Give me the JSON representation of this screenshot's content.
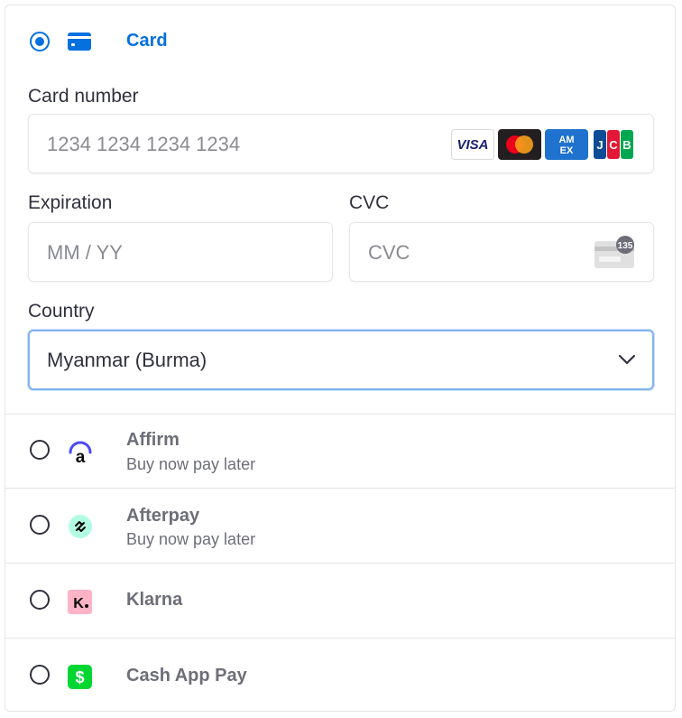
{
  "card": {
    "title": "Card",
    "card_number": {
      "label": "Card number",
      "placeholder": "1234 1234 1234 1234"
    },
    "brands": [
      "VISA",
      "Mastercard",
      "AMEX",
      "JCB"
    ],
    "expiration": {
      "label": "Expiration",
      "placeholder": "MM / YY"
    },
    "cvc": {
      "label": "CVC",
      "placeholder": "CVC",
      "hint_digits": "135"
    },
    "country": {
      "label": "Country",
      "value": "Myanmar (Burma)"
    }
  },
  "methods": [
    {
      "name": "Affirm",
      "subtitle": "Buy now pay later"
    },
    {
      "name": "Afterpay",
      "subtitle": "Buy now pay later"
    },
    {
      "name": "Klarna"
    },
    {
      "name": "Cash App Pay"
    }
  ],
  "colors": {
    "accent": "#0570de",
    "affirm": "#4a4af4",
    "afterpay": "#b2fce4",
    "klarna": "#ffb3c7",
    "cashapp": "#00d632"
  }
}
